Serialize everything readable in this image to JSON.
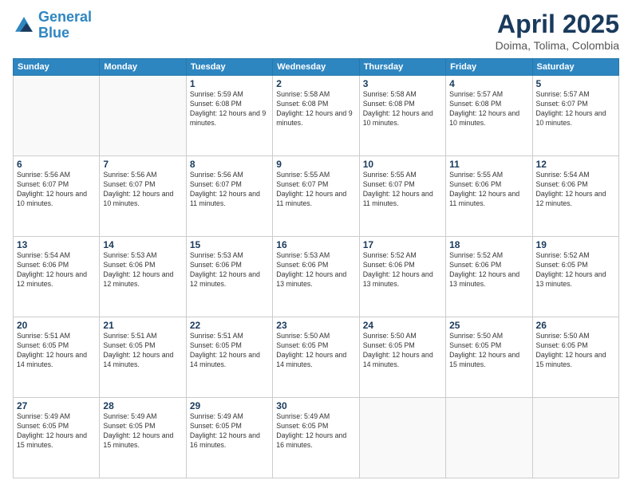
{
  "header": {
    "logo_line1": "General",
    "logo_line2": "Blue",
    "title": "April 2025",
    "subtitle": "Doima, Tolima, Colombia"
  },
  "weekdays": [
    "Sunday",
    "Monday",
    "Tuesday",
    "Wednesday",
    "Thursday",
    "Friday",
    "Saturday"
  ],
  "weeks": [
    [
      {
        "day": "",
        "info": ""
      },
      {
        "day": "",
        "info": ""
      },
      {
        "day": "1",
        "info": "Sunrise: 5:59 AM\nSunset: 6:08 PM\nDaylight: 12 hours and 9 minutes."
      },
      {
        "day": "2",
        "info": "Sunrise: 5:58 AM\nSunset: 6:08 PM\nDaylight: 12 hours and 9 minutes."
      },
      {
        "day": "3",
        "info": "Sunrise: 5:58 AM\nSunset: 6:08 PM\nDaylight: 12 hours and 10 minutes."
      },
      {
        "day": "4",
        "info": "Sunrise: 5:57 AM\nSunset: 6:08 PM\nDaylight: 12 hours and 10 minutes."
      },
      {
        "day": "5",
        "info": "Sunrise: 5:57 AM\nSunset: 6:07 PM\nDaylight: 12 hours and 10 minutes."
      }
    ],
    [
      {
        "day": "6",
        "info": "Sunrise: 5:56 AM\nSunset: 6:07 PM\nDaylight: 12 hours and 10 minutes."
      },
      {
        "day": "7",
        "info": "Sunrise: 5:56 AM\nSunset: 6:07 PM\nDaylight: 12 hours and 10 minutes."
      },
      {
        "day": "8",
        "info": "Sunrise: 5:56 AM\nSunset: 6:07 PM\nDaylight: 12 hours and 11 minutes."
      },
      {
        "day": "9",
        "info": "Sunrise: 5:55 AM\nSunset: 6:07 PM\nDaylight: 12 hours and 11 minutes."
      },
      {
        "day": "10",
        "info": "Sunrise: 5:55 AM\nSunset: 6:07 PM\nDaylight: 12 hours and 11 minutes."
      },
      {
        "day": "11",
        "info": "Sunrise: 5:55 AM\nSunset: 6:06 PM\nDaylight: 12 hours and 11 minutes."
      },
      {
        "day": "12",
        "info": "Sunrise: 5:54 AM\nSunset: 6:06 PM\nDaylight: 12 hours and 12 minutes."
      }
    ],
    [
      {
        "day": "13",
        "info": "Sunrise: 5:54 AM\nSunset: 6:06 PM\nDaylight: 12 hours and 12 minutes."
      },
      {
        "day": "14",
        "info": "Sunrise: 5:53 AM\nSunset: 6:06 PM\nDaylight: 12 hours and 12 minutes."
      },
      {
        "day": "15",
        "info": "Sunrise: 5:53 AM\nSunset: 6:06 PM\nDaylight: 12 hours and 12 minutes."
      },
      {
        "day": "16",
        "info": "Sunrise: 5:53 AM\nSunset: 6:06 PM\nDaylight: 12 hours and 13 minutes."
      },
      {
        "day": "17",
        "info": "Sunrise: 5:52 AM\nSunset: 6:06 PM\nDaylight: 12 hours and 13 minutes."
      },
      {
        "day": "18",
        "info": "Sunrise: 5:52 AM\nSunset: 6:06 PM\nDaylight: 12 hours and 13 minutes."
      },
      {
        "day": "19",
        "info": "Sunrise: 5:52 AM\nSunset: 6:05 PM\nDaylight: 12 hours and 13 minutes."
      }
    ],
    [
      {
        "day": "20",
        "info": "Sunrise: 5:51 AM\nSunset: 6:05 PM\nDaylight: 12 hours and 14 minutes."
      },
      {
        "day": "21",
        "info": "Sunrise: 5:51 AM\nSunset: 6:05 PM\nDaylight: 12 hours and 14 minutes."
      },
      {
        "day": "22",
        "info": "Sunrise: 5:51 AM\nSunset: 6:05 PM\nDaylight: 12 hours and 14 minutes."
      },
      {
        "day": "23",
        "info": "Sunrise: 5:50 AM\nSunset: 6:05 PM\nDaylight: 12 hours and 14 minutes."
      },
      {
        "day": "24",
        "info": "Sunrise: 5:50 AM\nSunset: 6:05 PM\nDaylight: 12 hours and 14 minutes."
      },
      {
        "day": "25",
        "info": "Sunrise: 5:50 AM\nSunset: 6:05 PM\nDaylight: 12 hours and 15 minutes."
      },
      {
        "day": "26",
        "info": "Sunrise: 5:50 AM\nSunset: 6:05 PM\nDaylight: 12 hours and 15 minutes."
      }
    ],
    [
      {
        "day": "27",
        "info": "Sunrise: 5:49 AM\nSunset: 6:05 PM\nDaylight: 12 hours and 15 minutes."
      },
      {
        "day": "28",
        "info": "Sunrise: 5:49 AM\nSunset: 6:05 PM\nDaylight: 12 hours and 15 minutes."
      },
      {
        "day": "29",
        "info": "Sunrise: 5:49 AM\nSunset: 6:05 PM\nDaylight: 12 hours and 16 minutes."
      },
      {
        "day": "30",
        "info": "Sunrise: 5:49 AM\nSunset: 6:05 PM\nDaylight: 12 hours and 16 minutes."
      },
      {
        "day": "",
        "info": ""
      },
      {
        "day": "",
        "info": ""
      },
      {
        "day": "",
        "info": ""
      }
    ]
  ]
}
